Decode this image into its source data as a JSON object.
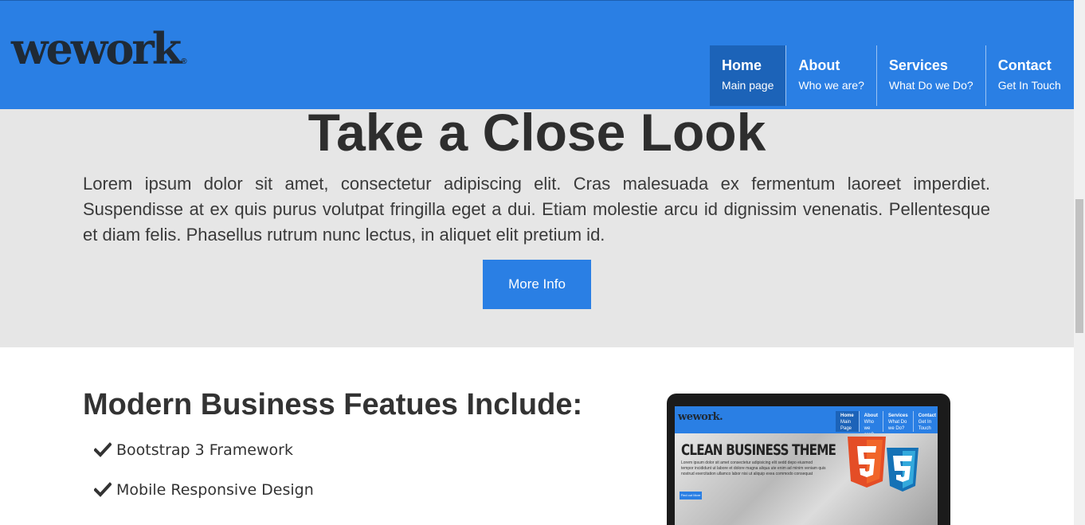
{
  "header": {
    "logo_text": "wework",
    "logo_mark": "®",
    "nav": [
      {
        "title": "Home",
        "subtitle": "Main page"
      },
      {
        "title": "About",
        "subtitle": "Who we are?"
      },
      {
        "title": "Services",
        "subtitle": "What Do we Do?"
      },
      {
        "title": "Contact",
        "subtitle": "Get In Touch"
      }
    ],
    "colors": {
      "header_bg": "#2a7fe4",
      "active_nav_bg": "#1c63b8"
    }
  },
  "hero": {
    "title": "Take a Close Look",
    "text": "Lorem ipsum dolor sit amet, consectetur adipiscing elit. Cras malesuada ex fermentum laoreet imperdiet. Suspendisse at ex quis purus volutpat fringilla eget a dui. Etiam molestie arcu id dignissim venenatis. Pellentesque et diam felis. Phasellus rutrum nunc lectus, in aliquet elit pretium id.",
    "button_label": "More Info"
  },
  "features": {
    "title": "Modern Business Featues Include:",
    "items": [
      {
        "label": "Bootstrap 3 Framework",
        "icon": "check-icon"
      },
      {
        "label": "Mobile Responsive Design",
        "icon": "check-icon"
      }
    ]
  },
  "laptop_preview": {
    "logo_text": "wework.",
    "nav": [
      {
        "title": "Home",
        "subtitle": "Main Page"
      },
      {
        "title": "About",
        "subtitle": "Who we are?"
      },
      {
        "title": "Services",
        "subtitle": "What Do we Do?"
      },
      {
        "title": "Contact",
        "subtitle": "Get In Touch"
      }
    ],
    "hero_title": "CLEAN BUSINESS THEME",
    "hero_text": "Lorem ipsum dolor sit amet consectetur adipisicing elit sedd depo eiusmod tempor incididunt ut labore et dolore magna aliqua ute enim ad minim veniam quis nostrud exercitation ullamco labor nisi ut aliquip exea commodo consequat",
    "button_label": "Find out More",
    "icons": [
      "html5-icon",
      "css3-icon"
    ]
  }
}
